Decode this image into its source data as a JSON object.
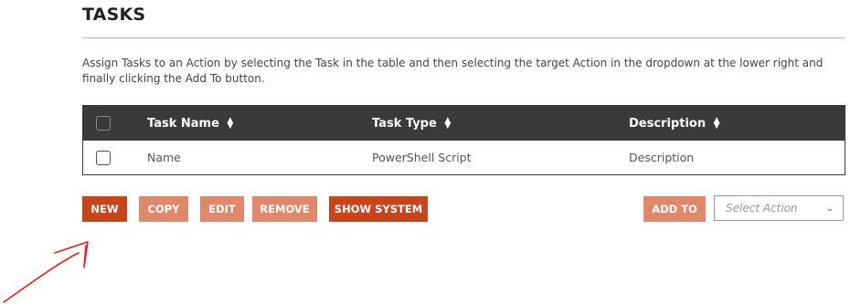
{
  "header": {
    "title": "TASKS"
  },
  "description": "Assign Tasks to an Action by selecting the Task in the table and then selecting the target Action in the dropdown at the lower right and finally clicking the Add To button.",
  "table": {
    "columns": [
      {
        "label": "Task Name",
        "sort_icon": "sort-icon"
      },
      {
        "label": "Task Type",
        "sort_icon": "sort-icon"
      },
      {
        "label": "Description",
        "sort_icon": "sort-icon"
      }
    ],
    "rows": [
      {
        "name": "Name",
        "type": "PowerShell Script",
        "description": "Description"
      }
    ]
  },
  "buttons": {
    "new": "NEW",
    "copy": "COPY",
    "edit": "EDIT",
    "remove": "REMOVE",
    "show_system": "SHOW SYSTEM",
    "add_to": "ADD TO"
  },
  "action_select": {
    "placeholder": "Select Action",
    "icon": "chevron-down-icon"
  },
  "colors": {
    "primary_button": "#c8441a",
    "disabled_button": "#e1876b",
    "table_header": "#3a3a3a",
    "annotation_arrow": "#e02020"
  }
}
